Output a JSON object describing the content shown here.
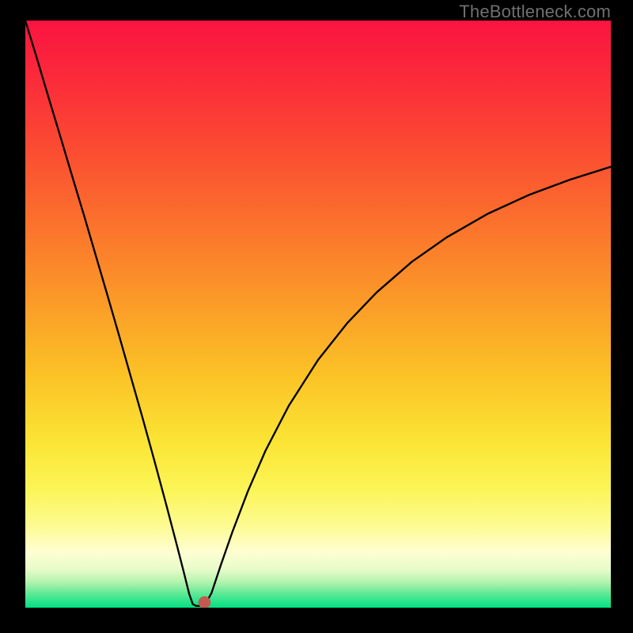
{
  "watermark": "TheBottleneck.com",
  "chart_data": {
    "type": "line",
    "title": "",
    "xlabel": "",
    "ylabel": "",
    "xlim": [
      0,
      100
    ],
    "ylim": [
      0,
      100
    ],
    "grid": false,
    "background_gradient": {
      "stops": [
        {
          "offset": 0.0,
          "color": "#fa1440"
        },
        {
          "offset": 0.1,
          "color": "#fb2b3a"
        },
        {
          "offset": 0.22,
          "color": "#fb4c32"
        },
        {
          "offset": 0.35,
          "color": "#fb732c"
        },
        {
          "offset": 0.48,
          "color": "#fb9b28"
        },
        {
          "offset": 0.6,
          "color": "#fbc126"
        },
        {
          "offset": 0.72,
          "color": "#fbe535"
        },
        {
          "offset": 0.8,
          "color": "#fcf558"
        },
        {
          "offset": 0.86,
          "color": "#fdfb91"
        },
        {
          "offset": 0.905,
          "color": "#fefed3"
        },
        {
          "offset": 0.935,
          "color": "#e7fbc8"
        },
        {
          "offset": 0.955,
          "color": "#b7f4b0"
        },
        {
          "offset": 0.975,
          "color": "#63e996"
        },
        {
          "offset": 1.0,
          "color": "#00e183"
        }
      ]
    },
    "series": [
      {
        "name": "bottleneck-curve",
        "color": "#000000",
        "x": [
          0.0,
          2,
          4,
          6,
          8,
          10,
          12,
          14,
          16,
          18,
          20,
          22,
          24,
          26,
          27,
          28,
          28.6,
          29.2,
          30.0,
          30.8,
          31.8,
          33.4,
          35.4,
          38,
          41,
          45,
          50,
          55,
          60,
          66,
          72,
          79,
          86,
          93,
          100
        ],
        "y": [
          100,
          93.5,
          86.8,
          80.2,
          73.5,
          66.9,
          60.1,
          53.3,
          46.4,
          39.4,
          32.4,
          25.2,
          17.8,
          10.2,
          6.3,
          2.3,
          0.6,
          0.3,
          0.3,
          0.7,
          2.5,
          7.3,
          13.0,
          19.8,
          26.7,
          34.4,
          42.2,
          48.5,
          53.7,
          58.9,
          63.1,
          67.1,
          70.3,
          72.9,
          75.1
        ]
      }
    ],
    "marker": {
      "name": "optimal-point",
      "x": 30.6,
      "y": 0.9,
      "r": 1.05,
      "color": "#c25a52"
    }
  }
}
